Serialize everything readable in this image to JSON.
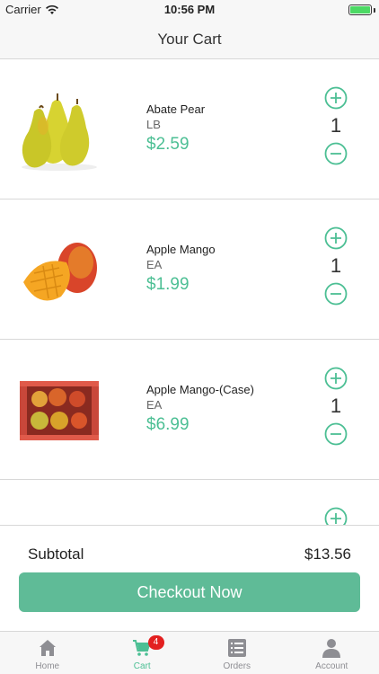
{
  "status_bar": {
    "carrier": "Carrier",
    "time": "10:56 PM",
    "battery_level": 1.0
  },
  "nav": {
    "title": "Your Cart"
  },
  "cart": {
    "items": [
      {
        "name": "Abate Pear",
        "unit": "LB",
        "price": "$2.59",
        "quantity": "1",
        "image_icon": "pear-icon"
      },
      {
        "name": "Apple Mango",
        "unit": "EA",
        "price": "$1.99",
        "quantity": "1",
        "image_icon": "mango-icon"
      },
      {
        "name": "Apple Mango-(Case)",
        "unit": "EA",
        "price": "$6.99",
        "quantity": "1",
        "image_icon": "mango-case-icon"
      }
    ]
  },
  "summary": {
    "subtotal_label": "Subtotal",
    "subtotal_value": "$13.56",
    "checkout_label": "Checkout Now"
  },
  "tabs": [
    {
      "label": "Home",
      "icon": "home-icon"
    },
    {
      "label": "Cart",
      "icon": "cart-icon",
      "badge": "4",
      "active": true
    },
    {
      "label": "Orders",
      "icon": "list-icon"
    },
    {
      "label": "Account",
      "icon": "person-icon"
    }
  ],
  "colors": {
    "accent": "#4cbf94",
    "button": "#5fbb97",
    "badge": "#e32020"
  }
}
